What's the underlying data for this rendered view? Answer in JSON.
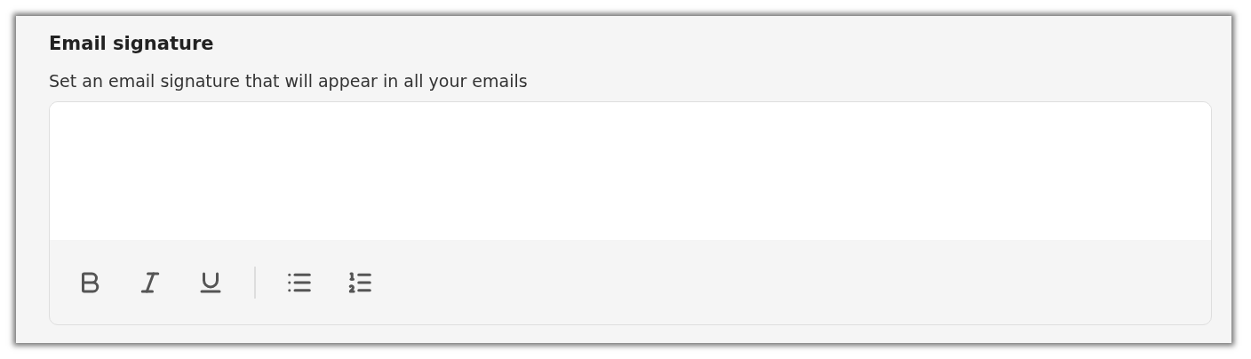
{
  "section": {
    "title": "Email signature",
    "description": "Set an email signature that will appear in all your emails"
  },
  "editor": {
    "toolbar": [
      {
        "kind": "bold"
      },
      {
        "kind": "italic"
      },
      {
        "kind": "underline"
      },
      {
        "kind": "divider"
      },
      {
        "kind": "bulleted-list"
      },
      {
        "kind": "numbered-list"
      }
    ]
  }
}
